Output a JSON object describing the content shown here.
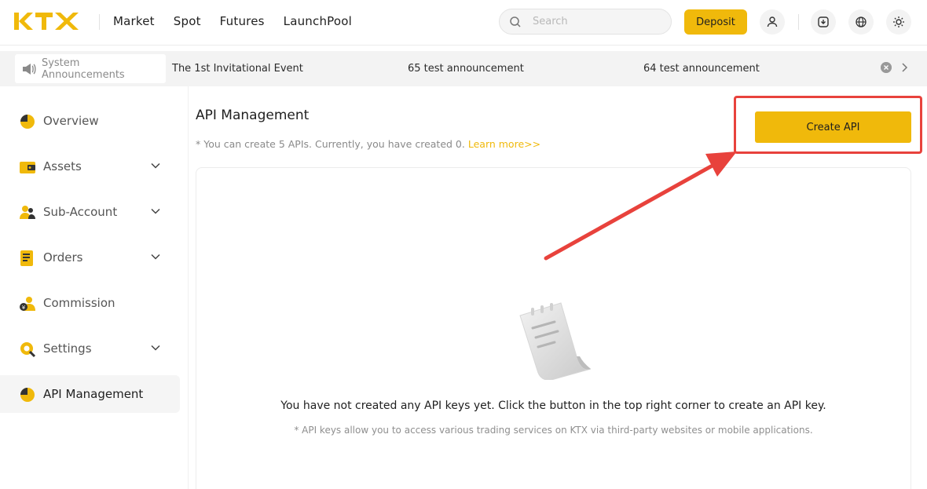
{
  "colors": {
    "brand": "#f0b90b",
    "highlight": "#e8423c"
  },
  "header": {
    "logo_text": "KTX",
    "nav": [
      "Market",
      "Spot",
      "Futures",
      "LaunchPool"
    ],
    "search_placeholder": "Search",
    "deposit_label": "Deposit",
    "icons": [
      "user-icon",
      "download-icon",
      "globe-icon",
      "sun-icon"
    ]
  },
  "announcements": {
    "label": "System Announcements",
    "items": [
      "The 1st Invitational Event",
      "65 test announcement",
      "64 test announcement"
    ]
  },
  "sidebar": {
    "items": [
      {
        "label": "Overview",
        "icon": "pie-chart-icon",
        "expandable": false,
        "active": false
      },
      {
        "label": "Assets",
        "icon": "wallet-icon",
        "expandable": true,
        "active": false
      },
      {
        "label": "Sub-Account",
        "icon": "users-icon",
        "expandable": true,
        "active": false
      },
      {
        "label": "Orders",
        "icon": "document-icon",
        "expandable": true,
        "active": false
      },
      {
        "label": "Commission",
        "icon": "commission-icon",
        "expandable": false,
        "active": false
      },
      {
        "label": "Settings",
        "icon": "settings-icon",
        "expandable": true,
        "active": false
      },
      {
        "label": "API Management",
        "icon": "pie-chart-icon",
        "expandable": false,
        "active": true
      }
    ]
  },
  "main": {
    "title": "API Management",
    "note": "* You can create 5 APIs. Currently, you have created 0.",
    "learn_more": "Learn more>>",
    "create_button": "Create API",
    "empty_title": "You have not created any API keys yet. Click the button in the top right corner to create an API key.",
    "empty_subtitle": "* API keys allow you to access various trading services on KTX via third-party websites or mobile applications."
  }
}
